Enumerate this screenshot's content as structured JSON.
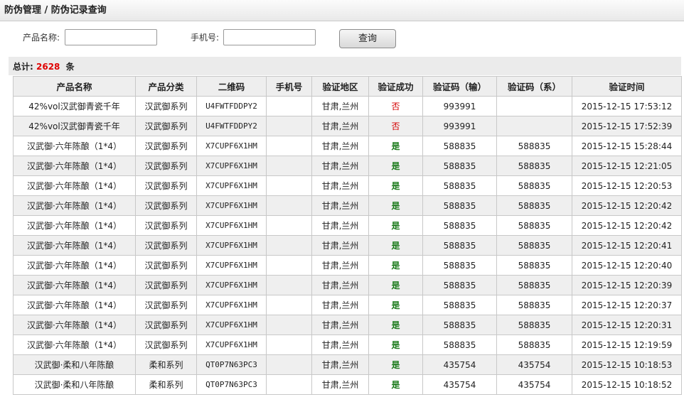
{
  "breadcrumb": "防伪管理 / 防伪记录查询",
  "search": {
    "product_label": "产品名称:",
    "product_value": "",
    "phone_label": "手机号:",
    "phone_value": "",
    "query_button": "查询"
  },
  "summary": {
    "prefix": "总计:",
    "count": "2628",
    "unit": "条"
  },
  "table": {
    "headers": [
      "产品名称",
      "产品分类",
      "二维码",
      "手机号",
      "验证地区",
      "验证成功",
      "验证码（输）",
      "验证码（系）",
      "验证时间"
    ],
    "rows": [
      [
        "42%vol汉武御青瓷千年",
        "汉武御系列",
        "U4FWTFDDPY2",
        "",
        "甘肃,兰州",
        "否",
        "993991",
        "",
        "2015-12-15 17:53:12"
      ],
      [
        "42%vol汉武御青瓷千年",
        "汉武御系列",
        "U4FWTFDDPY2",
        "",
        "甘肃,兰州",
        "否",
        "993991",
        "",
        "2015-12-15 17:52:39"
      ],
      [
        "汉武御·六年陈酿（1*4）",
        "汉武御系列",
        "X7CUPF6X1HM",
        "",
        "甘肃,兰州",
        "是",
        "588835",
        "588835",
        "2015-12-15 15:28:44"
      ],
      [
        "汉武御·六年陈酿（1*4）",
        "汉武御系列",
        "X7CUPF6X1HM",
        "",
        "甘肃,兰州",
        "是",
        "588835",
        "588835",
        "2015-12-15 12:21:05"
      ],
      [
        "汉武御·六年陈酿（1*4）",
        "汉武御系列",
        "X7CUPF6X1HM",
        "",
        "甘肃,兰州",
        "是",
        "588835",
        "588835",
        "2015-12-15 12:20:53"
      ],
      [
        "汉武御·六年陈酿（1*4）",
        "汉武御系列",
        "X7CUPF6X1HM",
        "",
        "甘肃,兰州",
        "是",
        "588835",
        "588835",
        "2015-12-15 12:20:42"
      ],
      [
        "汉武御·六年陈酿（1*4）",
        "汉武御系列",
        "X7CUPF6X1HM",
        "",
        "甘肃,兰州",
        "是",
        "588835",
        "588835",
        "2015-12-15 12:20:42"
      ],
      [
        "汉武御·六年陈酿（1*4）",
        "汉武御系列",
        "X7CUPF6X1HM",
        "",
        "甘肃,兰州",
        "是",
        "588835",
        "588835",
        "2015-12-15 12:20:41"
      ],
      [
        "汉武御·六年陈酿（1*4）",
        "汉武御系列",
        "X7CUPF6X1HM",
        "",
        "甘肃,兰州",
        "是",
        "588835",
        "588835",
        "2015-12-15 12:20:40"
      ],
      [
        "汉武御·六年陈酿（1*4）",
        "汉武御系列",
        "X7CUPF6X1HM",
        "",
        "甘肃,兰州",
        "是",
        "588835",
        "588835",
        "2015-12-15 12:20:39"
      ],
      [
        "汉武御·六年陈酿（1*4）",
        "汉武御系列",
        "X7CUPF6X1HM",
        "",
        "甘肃,兰州",
        "是",
        "588835",
        "588835",
        "2015-12-15 12:20:37"
      ],
      [
        "汉武御·六年陈酿（1*4）",
        "汉武御系列",
        "X7CUPF6X1HM",
        "",
        "甘肃,兰州",
        "是",
        "588835",
        "588835",
        "2015-12-15 12:20:31"
      ],
      [
        "汉武御·六年陈酿（1*4）",
        "汉武御系列",
        "X7CUPF6X1HM",
        "",
        "甘肃,兰州",
        "是",
        "588835",
        "588835",
        "2015-12-15 12:19:59"
      ],
      [
        "汉武御·柔和八年陈酿",
        "柔和系列",
        "QT0P7N63PC3",
        "",
        "甘肃,兰州",
        "是",
        "435754",
        "435754",
        "2015-12-15 10:18:53"
      ],
      [
        "汉武御·柔和八年陈酿",
        "柔和系列",
        "QT0P7N63PC3",
        "",
        "甘肃,兰州",
        "是",
        "435754",
        "435754",
        "2015-12-15 10:18:52"
      ]
    ]
  },
  "colors": {
    "success_yes": "#1a7a1a",
    "success_no": "#d40000",
    "count": "#e00000"
  }
}
